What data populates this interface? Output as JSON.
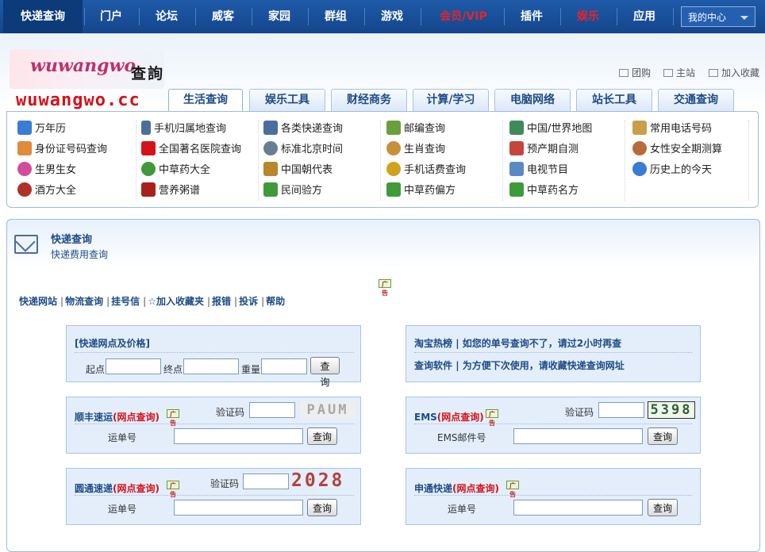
{
  "topnav": {
    "items": [
      {
        "label": "快递查询",
        "color": "#ffffff"
      },
      {
        "label": "门户",
        "color": "#ffffff"
      },
      {
        "label": "论坛",
        "color": "#ffffff"
      },
      {
        "label": "威客",
        "color": "#ffffff"
      },
      {
        "label": "家园",
        "color": "#ffffff"
      },
      {
        "label": "群组",
        "color": "#ffffff"
      },
      {
        "label": "游戏",
        "color": "#ffffff"
      },
      {
        "label": "会员/VIP",
        "color": "#e0262d"
      },
      {
        "label": "插件",
        "color": "#ffffff"
      },
      {
        "label": "娱乐",
        "color": "#e0262d"
      },
      {
        "label": "应用",
        "color": "#ffffff"
      }
    ],
    "my_center": "我的中心"
  },
  "header": {
    "logo_text": "wuwangwo",
    "title": "查詢",
    "domain": "wuwangwo.cc",
    "links": [
      "团购",
      "主站",
      "加入收藏"
    ]
  },
  "tabs": [
    "生活查询",
    "娱乐工具",
    "财经商务",
    "计算/学习",
    "电脑网络",
    "站长工具",
    "交通查询"
  ],
  "categories": [
    [
      {
        "label": "万年历",
        "icon": "calendar-icon",
        "color": "#3a7bd5"
      },
      {
        "label": "身份证号码查询",
        "icon": "id-card-icon",
        "color": "#e08a3c"
      },
      {
        "label": "生男生女",
        "icon": "gender-icon",
        "color": "#d14d9c"
      },
      {
        "label": "酒方大全",
        "icon": "wine-icon",
        "color": "#b0302a"
      }
    ],
    [
      {
        "label": "手机归属地查询",
        "icon": "mobile-icon",
        "color": "#4c6f99"
      },
      {
        "label": "全国著名医院查询",
        "icon": "hospital-icon",
        "color": "#d4121a"
      },
      {
        "label": "中草药大全",
        "icon": "herb-icon",
        "color": "#3f9a3a"
      },
      {
        "label": "营养粥谱",
        "icon": "porridge-icon",
        "color": "#a8201a"
      }
    ],
    [
      {
        "label": "各类快递查询",
        "icon": "envelope-icon",
        "color": "#4a6e9e"
      },
      {
        "label": "标准北京时间",
        "icon": "clock-icon",
        "color": "#6a7d93"
      },
      {
        "label": "中国朝代表",
        "icon": "scroll-icon",
        "color": "#b8862b"
      },
      {
        "label": "民间验方",
        "icon": "remedy-icon",
        "color": "#3f9a3a"
      }
    ],
    [
      {
        "label": "邮编查询",
        "icon": "postcode-icon",
        "color": "#6aa03c"
      },
      {
        "label": "生肖查询",
        "icon": "zodiac-icon",
        "color": "#c8903a"
      },
      {
        "label": "手机话费查询",
        "icon": "coin-icon",
        "color": "#d1a21c"
      },
      {
        "label": "中草药偏方",
        "icon": "remedy-icon",
        "color": "#3f9a3a"
      }
    ],
    [
      {
        "label": "中国/世界地图",
        "icon": "map-icon",
        "color": "#3f8a5a"
      },
      {
        "label": "预产期自测",
        "icon": "date-icon",
        "color": "#c4463a"
      },
      {
        "label": "电视节目",
        "icon": "tv-icon",
        "color": "#5a8ac4"
      },
      {
        "label": "中草药名方",
        "icon": "remedy-icon",
        "color": "#3f9a3a"
      }
    ],
    [
      {
        "label": "常用电话号码",
        "icon": "phone-icon",
        "color": "#c8a04a"
      },
      {
        "label": "女性安全期测算",
        "icon": "female-icon",
        "color": "#b86a3a"
      },
      {
        "label": "历史上的今天",
        "icon": "globe-icon",
        "color": "#3a7bd5"
      }
    ]
  ],
  "main": {
    "title": "快递查询",
    "subtitle": "快递费用查询",
    "ad_tag": "广告",
    "links": [
      "快递网站",
      "物流查询",
      "挂号信",
      "☆加入收藏夹",
      "报错",
      "投诉",
      "帮助"
    ]
  },
  "boxes": {
    "network": {
      "title": "[快递网点及价格]",
      "from_label": "起点",
      "to_label": "终点",
      "weight_label": "重量",
      "button": "查询"
    },
    "taobao": {
      "line1_title": "淘宝热榜",
      "line1_text": "如您的单号查询不了，请过2小时再查",
      "line2_title": "查询软件",
      "line2_text": "为方便下次使用，请收藏快递查询网址"
    },
    "sf": {
      "name": "顺丰速运",
      "net_link": "(网点查询)",
      "captcha_label": "验证码",
      "captcha": "PAUM",
      "field_label": "运单号",
      "button": "查询"
    },
    "ems": {
      "name": "EMS",
      "net_link": "(网点查询)",
      "captcha_label": "验证码",
      "captcha": "5398",
      "field_label": "EMS邮件号",
      "button": "查询"
    },
    "yt": {
      "name": "圆通速递",
      "net_link": "(网点查询)",
      "captcha_label": "验证码",
      "captcha": "2028",
      "field_label": "运单号",
      "button": "查询"
    },
    "sto": {
      "name": "申通快递",
      "net_link": "(网点查询)",
      "field_label": "运单号",
      "button": "查询"
    }
  }
}
